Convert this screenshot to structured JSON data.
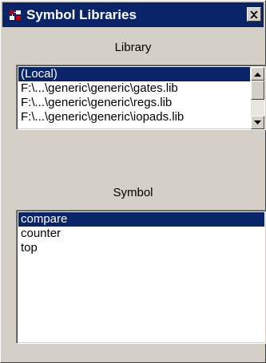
{
  "window": {
    "title": "Symbol Libraries",
    "close_glyph": "✕",
    "title_bar_color": "#0a246a",
    "face_color": "#d4d0c8"
  },
  "library": {
    "label": "Library",
    "items": [
      {
        "label": "(Local)",
        "selected": true
      },
      {
        "label": "F:\\...\\generic\\generic\\gates.lib",
        "selected": false
      },
      {
        "label": "F:\\...\\generic\\generic\\regs.lib",
        "selected": false
      },
      {
        "label": "F:\\...\\generic\\generic\\iopads.lib",
        "selected": false
      }
    ]
  },
  "symbol": {
    "label": "Symbol",
    "items": [
      {
        "label": "compare",
        "selected": true
      },
      {
        "label": "counter",
        "selected": false
      },
      {
        "label": "top",
        "selected": false
      }
    ]
  },
  "icons": {
    "app": "symbol-libraries-icon",
    "close": "close-icon",
    "scroll_up": "scroll-up-arrow-icon",
    "scroll_down": "scroll-down-arrow-icon"
  }
}
